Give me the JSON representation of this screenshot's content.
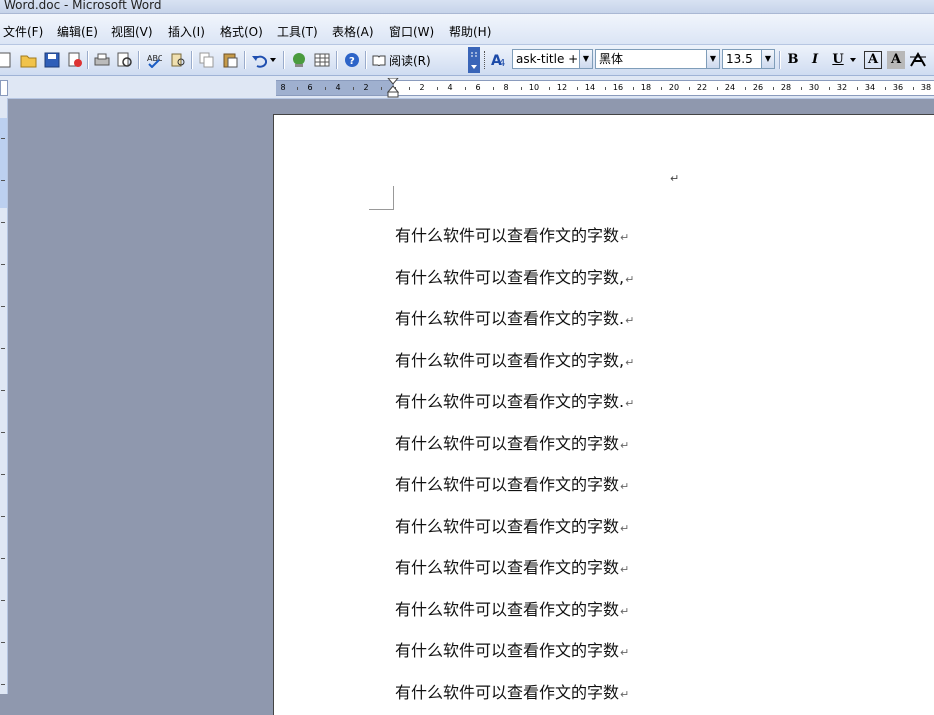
{
  "window": {
    "title": "Word.doc - Microsoft Word"
  },
  "menu": [
    "文件(F)",
    "编辑(E)",
    "视图(V)",
    "插入(I)",
    "格式(O)",
    "工具(T)",
    "表格(A)",
    "窗口(W)",
    "帮助(H)"
  ],
  "toolbar": {
    "read_label": "阅读(R)",
    "style": "ask-title +",
    "font": "黑体",
    "font_size": "13.5",
    "bold": "B",
    "italic": "I",
    "underline": "U",
    "char_border": "A",
    "char_shading": "A"
  },
  "ruler": {
    "labels": [
      "8",
      "6",
      "4",
      "2",
      "2",
      "4",
      "6",
      "8",
      "10",
      "12",
      "14",
      "16",
      "18",
      "20",
      "22",
      "24",
      "26",
      "28",
      "30",
      "32",
      "34",
      "36",
      "38"
    ]
  },
  "document": {
    "paragraph_mark": "↵",
    "lines": [
      "有什么软件可以查看作文的字数",
      "有什么软件可以查看作文的字数,",
      "有什么软件可以查看作文的字数.",
      "有什么软件可以查看作文的字数,",
      "有什么软件可以查看作文的字数.",
      "有什么软件可以查看作文的字数",
      "有什么软件可以查看作文的字数",
      "有什么软件可以查看作文的字数",
      "有什么软件可以查看作文的字数",
      "有什么软件可以查看作文的字数",
      "有什么软件可以查看作文的字数",
      "有什么软件可以查看作文的字数"
    ]
  },
  "colors": {
    "workspace": "#8f98ae",
    "toolbar": "#dbe5f5",
    "page": "#ffffff"
  },
  "icons": [
    "new-document-icon",
    "open-icon",
    "save-icon",
    "permission-icon",
    "print-icon",
    "print-preview-icon",
    "spelling-icon",
    "research-icon",
    "copy-icon",
    "paste-icon",
    "undo-icon",
    "hyperlink-icon",
    "table-icon",
    "help-icon",
    "read-icon",
    "styles-icon",
    "char-scale-icon"
  ]
}
